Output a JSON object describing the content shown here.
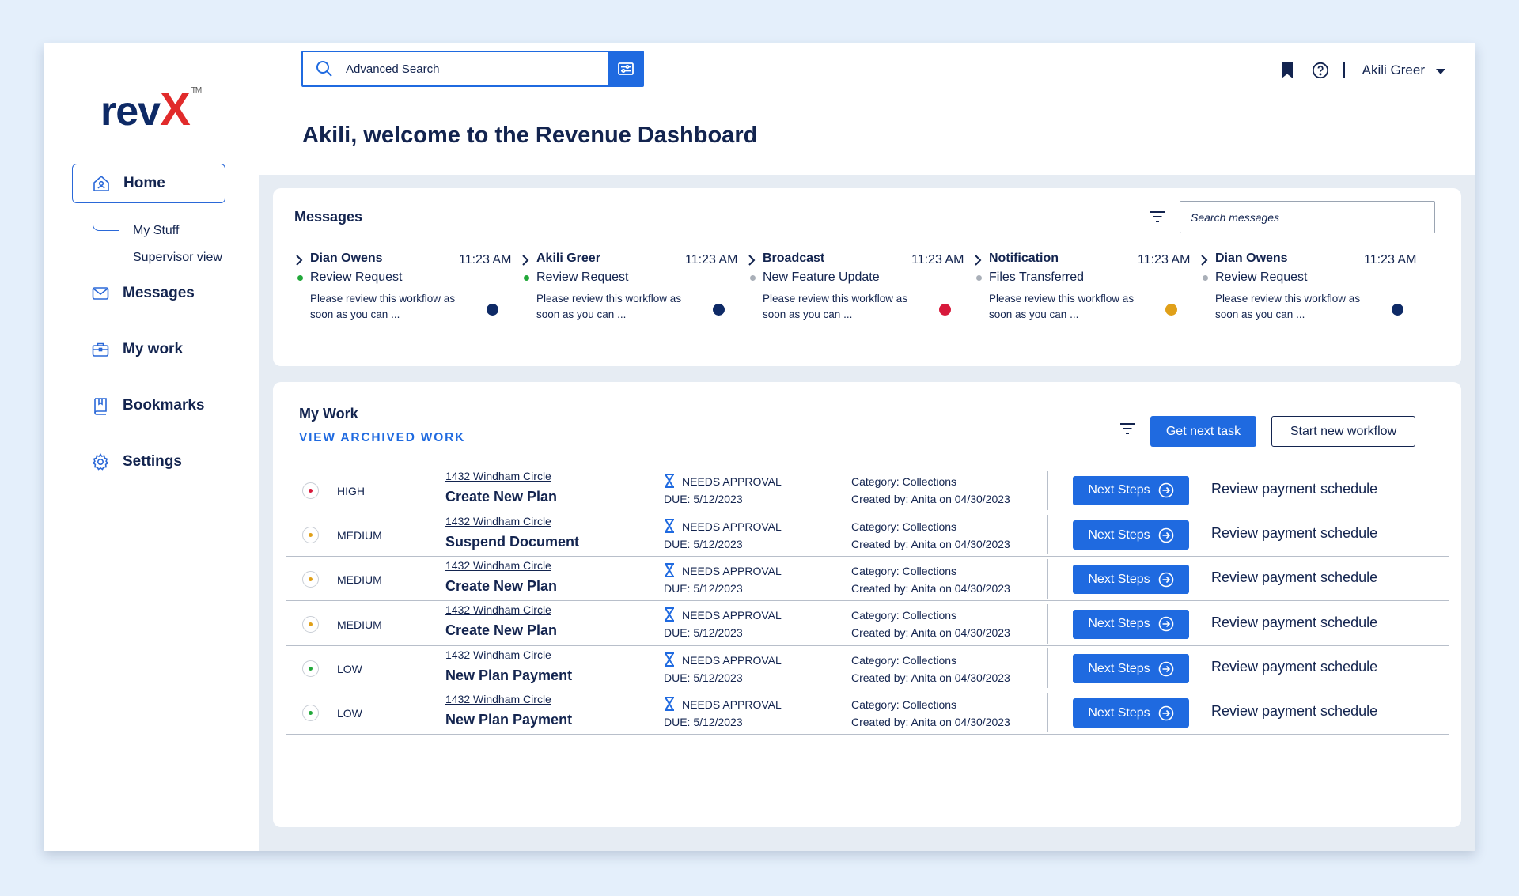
{
  "brand": {
    "name": "rev",
    "mark": "X",
    "tm": "TM"
  },
  "header": {
    "search_placeholder": "Advanced Search",
    "user_name": "Akili Greer",
    "welcome": "Akili, welcome to the Revenue Dashboard"
  },
  "sidebar": {
    "home": "Home",
    "sub_items": [
      "My Stuff",
      "Supervisor view"
    ],
    "items": [
      {
        "label": "Messages",
        "icon": "envelope-icon"
      },
      {
        "label": "My work",
        "icon": "briefcase-icon"
      },
      {
        "label": "Bookmarks",
        "icon": "book-icon"
      },
      {
        "label": "Settings",
        "icon": "gear-icon"
      }
    ]
  },
  "messages": {
    "title": "Messages",
    "search_placeholder": "Search messages",
    "items": [
      {
        "from": "Dian Owens",
        "time": "11:23 AM",
        "status_color": "#22a83a",
        "subject": "Review Request",
        "body": "Please review this workflow as soon as you can ...",
        "priority_color": "#0e2a66"
      },
      {
        "from": "Akili Greer",
        "time": "11:23 AM",
        "status_color": "#22a83a",
        "subject": "Review Request",
        "body": "Please review this workflow as soon as you can ...",
        "priority_color": "#0e2a66"
      },
      {
        "from": "Broadcast",
        "time": "11:23 AM",
        "status_color": "#a9afb8",
        "subject": "New Feature Update",
        "body": "Please review this workflow as soon as you can ...",
        "priority_color": "#d7193b"
      },
      {
        "from": "Notification",
        "time": "11:23 AM",
        "status_color": "#a9afb8",
        "subject": "Files Transferred",
        "body": "Please review this workflow as soon as you can ...",
        "priority_color": "#e0a019"
      },
      {
        "from": "Dian Owens",
        "time": "11:23 AM",
        "status_color": "#a9afb8",
        "subject": "Review Request",
        "body": "Please review this workflow as soon as you can ...",
        "priority_color": "#0e2a66"
      }
    ]
  },
  "work": {
    "title": "My Work",
    "archived_link": "VIEW ARCHIVED WORK",
    "get_next_task": "Get next task",
    "start_new_workflow": "Start new workflow",
    "rows": [
      {
        "priority": "HIGH",
        "priority_color": "#d7193b",
        "address": "1432 Windham Circle",
        "title": "Create New Plan",
        "status": "NEEDS APPROVAL",
        "due": "DUE: 5/12/2023",
        "category": "Category: Collections",
        "created": "Created by: Anita on 04/30/2023",
        "button": "Next Steps",
        "action": "Review payment schedule"
      },
      {
        "priority": "MEDIUM",
        "priority_color": "#e0a019",
        "address": "1432 Windham Circle",
        "title": "Suspend Document",
        "status": "NEEDS APPROVAL",
        "due": "DUE: 5/12/2023",
        "category": "Category: Collections",
        "created": "Created by: Anita on 04/30/2023",
        "button": "Next Steps",
        "action": "Review payment schedule"
      },
      {
        "priority": "MEDIUM",
        "priority_color": "#e0a019",
        "address": "1432 Windham Circle",
        "title": "Create New Plan",
        "status": "NEEDS APPROVAL",
        "due": "DUE: 5/12/2023",
        "category": "Category: Collections",
        "created": "Created by: Anita on 04/30/2023",
        "button": "Next Steps",
        "action": "Review payment schedule"
      },
      {
        "priority": "MEDIUM",
        "priority_color": "#e0a019",
        "address": "1432 Windham Circle",
        "title": "Create New Plan",
        "status": "NEEDS APPROVAL",
        "due": "DUE: 5/12/2023",
        "category": "Category: Collections",
        "created": "Created by: Anita on 04/30/2023",
        "button": "Next Steps",
        "action": "Review payment schedule"
      },
      {
        "priority": "LOW",
        "priority_color": "#22a83a",
        "address": "1432 Windham Circle",
        "title": "New Plan Payment",
        "status": "NEEDS APPROVAL",
        "due": "DUE: 5/12/2023",
        "category": "Category: Collections",
        "created": "Created by: Anita on 04/30/2023",
        "button": "Next Steps",
        "action": "Review payment schedule"
      },
      {
        "priority": "LOW",
        "priority_color": "#22a83a",
        "address": "1432 Windham Circle",
        "title": "New Plan Payment",
        "status": "NEEDS APPROVAL",
        "due": "DUE: 5/12/2023",
        "category": "Category: Collections",
        "created": "Created by: Anita on 04/30/2023",
        "button": "Next Steps",
        "action": "Review payment schedule"
      }
    ]
  },
  "colors": {
    "accent": "#1f6ae0",
    "navy": "#13244f",
    "brand_red": "#e12b2b"
  }
}
